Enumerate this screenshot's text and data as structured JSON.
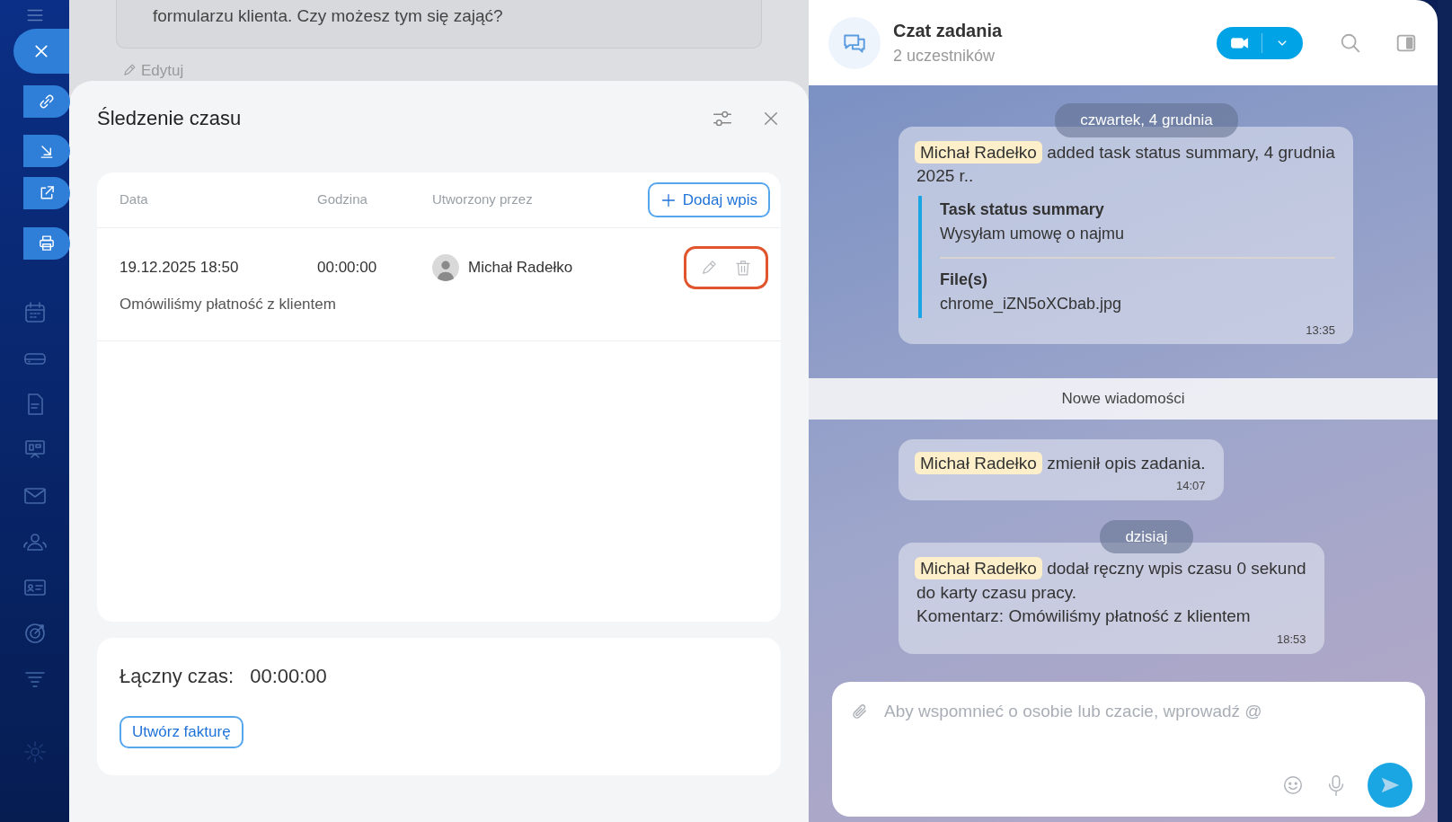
{
  "background_task": {
    "description_tail": "formularzu klienta. Czy możesz tym się zająć?",
    "edit_link": "Edytuj"
  },
  "time_tracking": {
    "title": "Śledzenie czasu",
    "columns": [
      "Data",
      "Godzina",
      "Utworzony przez"
    ],
    "add_button": "Dodaj wpis",
    "rows": [
      {
        "date": "19.12.2025 18:50",
        "duration": "00:00:00",
        "author": "Michał Radełko",
        "comment": "Omówiliśmy płatność z klientem",
        "highlighted": true
      }
    ],
    "total_label": "Łączny czas:",
    "total_value": "00:00:00",
    "invoice_button": "Utwórz fakturę"
  },
  "chat": {
    "title": "Czat zadania",
    "subtitle": "2 uczestników",
    "messages": [
      {
        "kind": "date",
        "text": "czwartek, 4 grudnia"
      },
      {
        "kind": "message",
        "author": "Michał Radełko",
        "lines": [
          "added task status summary, 4 grudnia",
          "2025 r.."
        ],
        "attachment": {
          "title": "Task status summary",
          "text": "Wysyłam umowę o najmu",
          "files_label": "File(s)",
          "file": "chrome_iZN5oXCbab.jpg"
        },
        "time": "13:35"
      },
      {
        "kind": "divider",
        "text": "Nowe wiadomości"
      },
      {
        "kind": "message",
        "author": "Michał Radełko",
        "lines": [
          "zmienił opis zadania."
        ],
        "time": "14:07"
      },
      {
        "kind": "date",
        "text": "dzisiaj"
      },
      {
        "kind": "message",
        "author": "Michał Radełko",
        "lines": [
          "dodał ręczny wpis czasu 0 sekund",
          "do karty czasu pracy.",
          "Komentarz: Omówiliśmy płatność z klientem"
        ],
        "time": "18:53"
      }
    ],
    "composer": {
      "placeholder": "Aby wspomnieć o osobie lub czacie, wprowadź @"
    }
  }
}
